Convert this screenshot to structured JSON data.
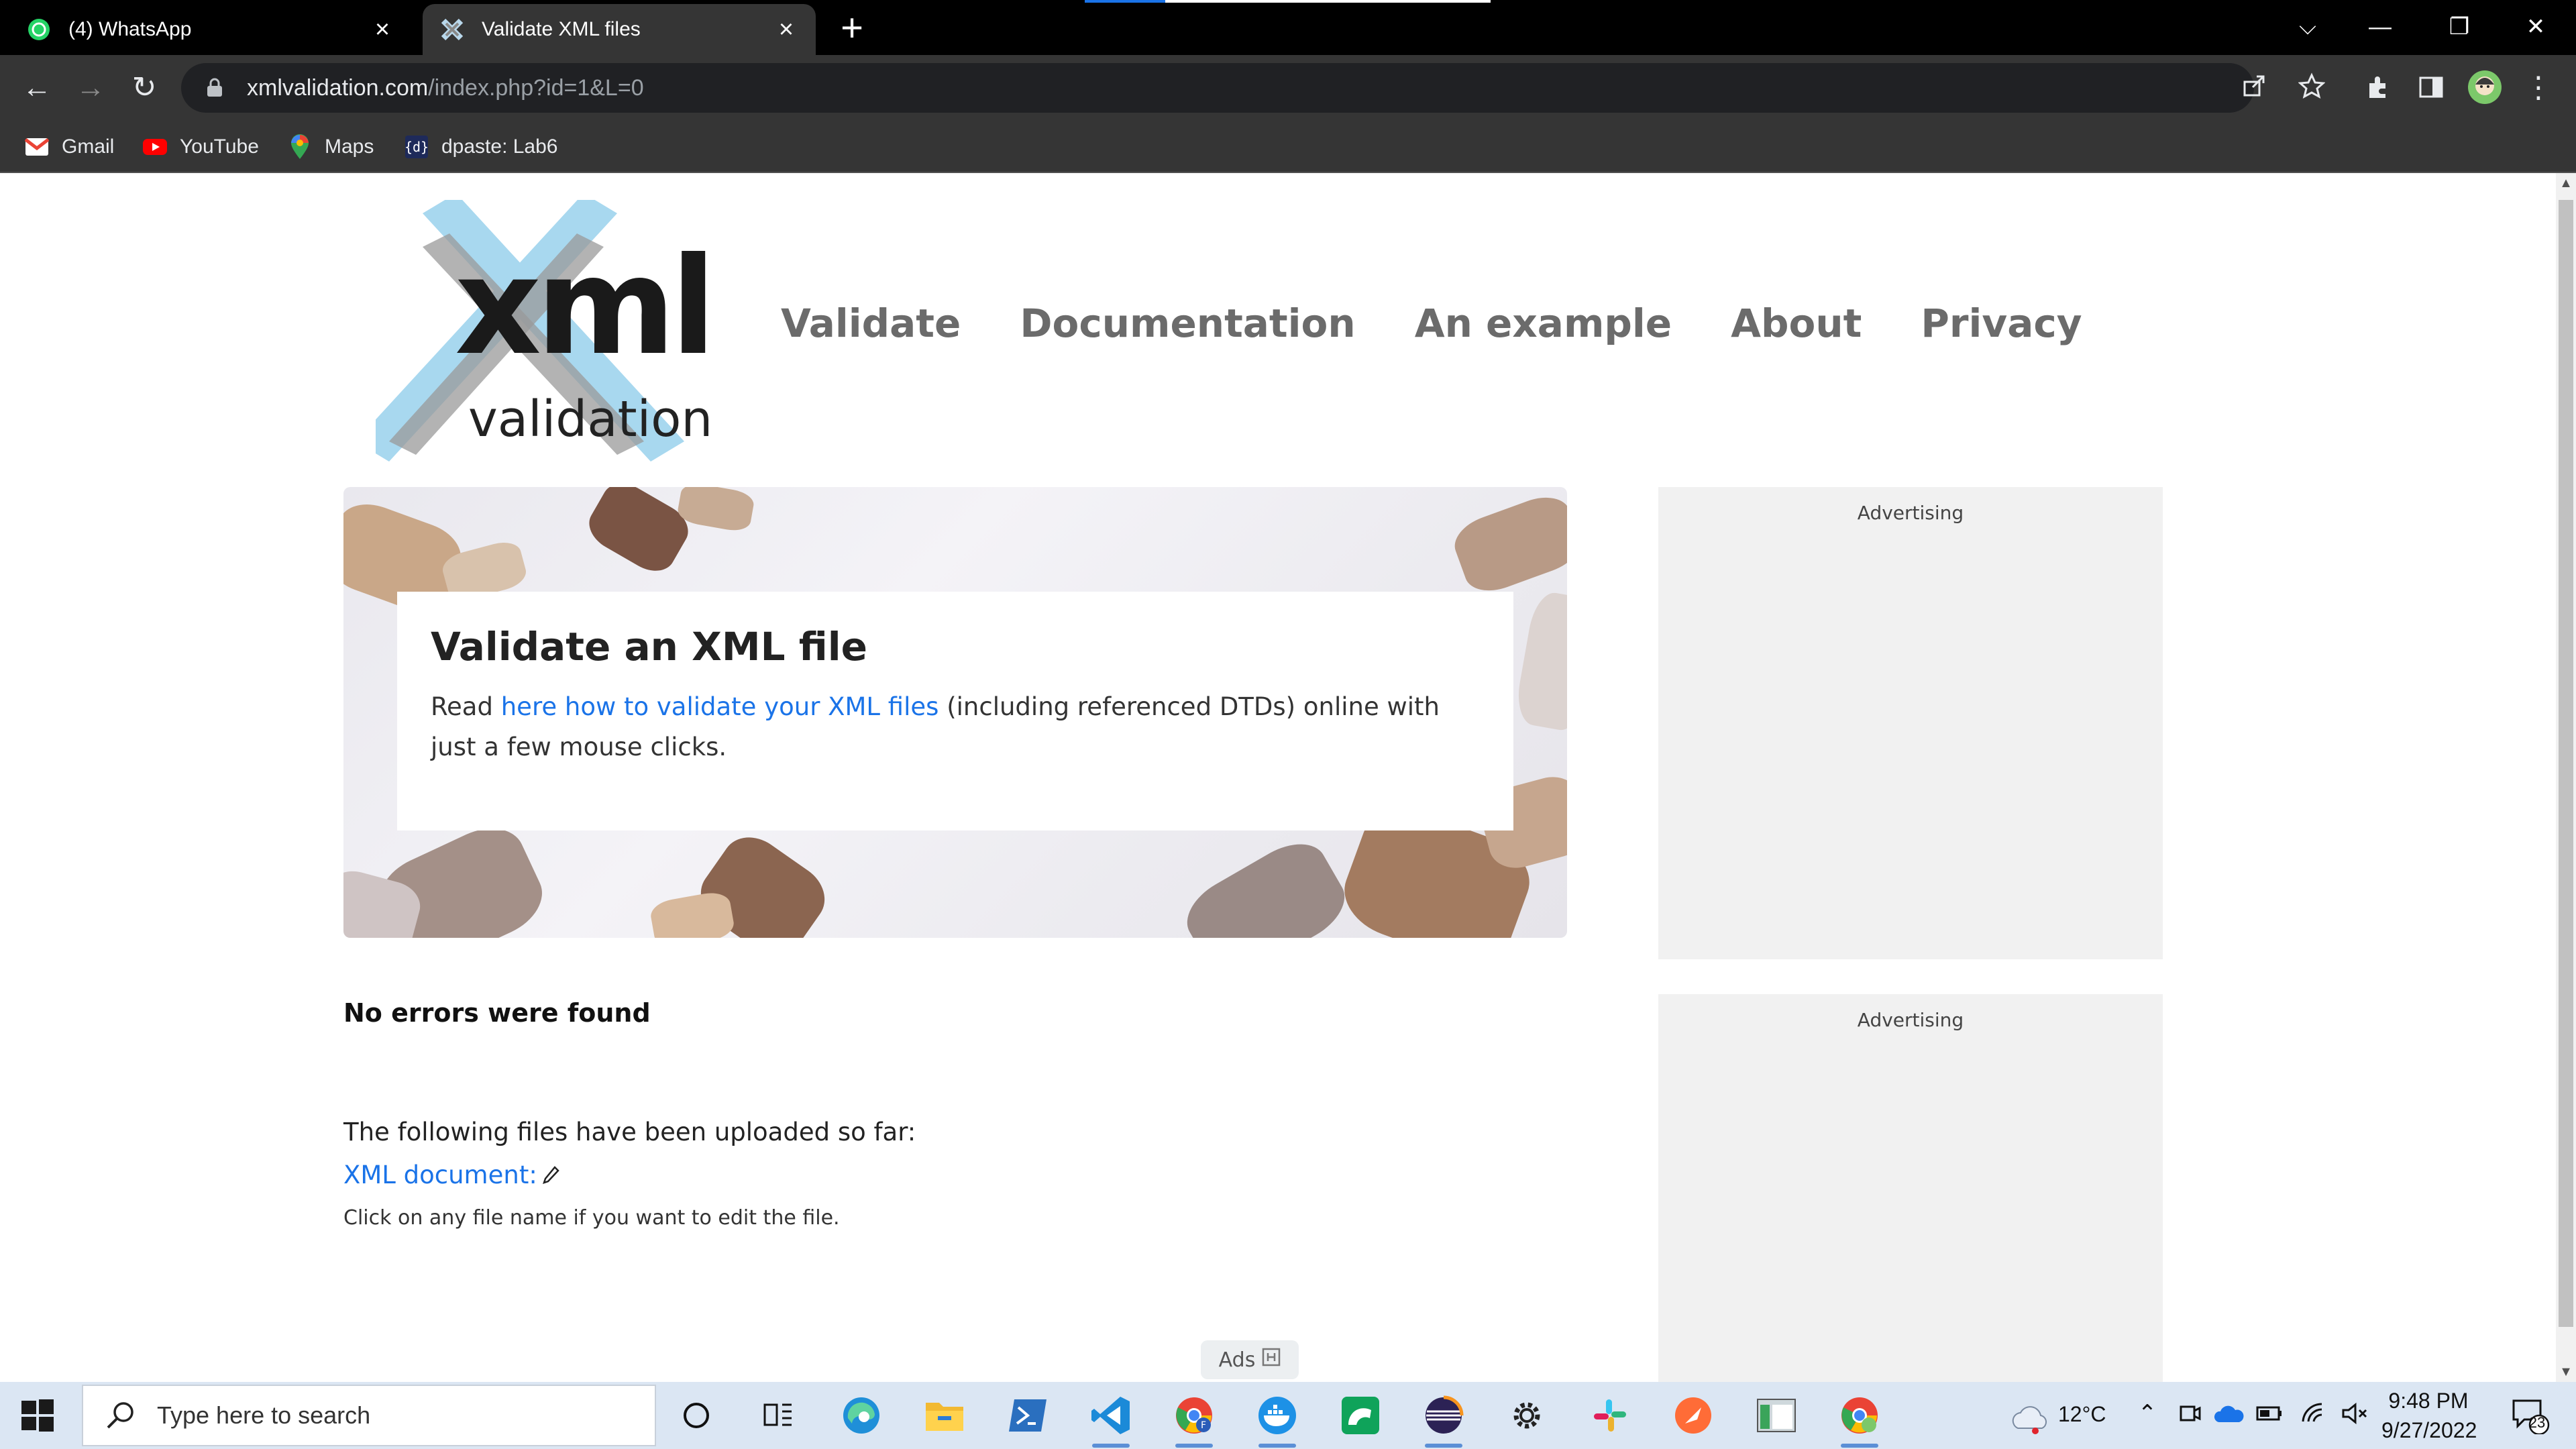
{
  "browser": {
    "tabs": [
      {
        "title": "(4) WhatsApp",
        "icon": "whatsapp-icon",
        "active": false
      },
      {
        "title": "Validate XML files",
        "icon": "xml-favicon-icon",
        "active": true
      }
    ],
    "url": {
      "host": "xmlvalidation.com",
      "path": "/index.php?id=1&L=0"
    },
    "bookmarks": [
      {
        "label": "Gmail",
        "icon": "gmail-icon"
      },
      {
        "label": "YouTube",
        "icon": "youtube-icon"
      },
      {
        "label": "Maps",
        "icon": "maps-icon"
      },
      {
        "label": "dpaste: Lab6",
        "icon": "dpaste-icon"
      }
    ]
  },
  "site": {
    "logo": {
      "main": "xml",
      "sub": "validation"
    },
    "nav": [
      "Validate",
      "Documentation",
      "An example",
      "About",
      "Privacy"
    ],
    "hero": {
      "title": "Validate an XML file",
      "text_before": "Read ",
      "link": "here how to validate your XML files",
      "text_after": " (including referenced DTDs) online with just a few mouse clicks."
    },
    "result": "No errors were found",
    "uploaded_label": "The following files have been uploaded so far:",
    "file_link": "XML document:",
    "edit_hint": "Click on any file name if you want to edit the file.",
    "ads": [
      "Advertising",
      "Advertising"
    ],
    "ads_chip": "Ads"
  },
  "taskbar": {
    "search_placeholder": "Type here to search",
    "weather": "12°C",
    "time": "9:48 PM",
    "date": "9/27/2022",
    "notifications": "23"
  },
  "colors": {
    "link": "#1a73e8",
    "nav": "#6b6b6b",
    "logo_accent": "#a8d8ef"
  }
}
